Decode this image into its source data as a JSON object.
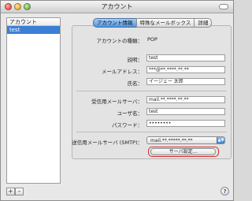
{
  "window": {
    "title": "アカウント"
  },
  "sidebar": {
    "header": "アカウント",
    "items": [
      {
        "label": "test",
        "selected": true
      }
    ],
    "add_label": "+",
    "remove_label": "–"
  },
  "tabs": [
    {
      "label": "アカウント情報",
      "active": true
    },
    {
      "label": "特殊なメールボックス",
      "active": false
    },
    {
      "label": "詳細",
      "active": false
    }
  ],
  "form": {
    "account_type_label": "アカウントの種類：",
    "account_type_value": "POP",
    "description_label": "説明：",
    "description_value": "test",
    "email_label": "メールアドレス：",
    "email_value": "***@**.****.**.**",
    "fullname_label": "氏名：",
    "fullname_value": "イージェー 太郎",
    "incoming_server_label": "受信用メールサーバ：",
    "incoming_server_value": "mail.**.****.**.**",
    "username_label": "ユーザ名：",
    "username_value": "test",
    "password_label": "パスワード：",
    "password_value": "••••••••",
    "smtp_label": "送信用メールサーバ (SMTP)：",
    "smtp_value": "mail.**.*****.**.**",
    "server_settings_button": "サーバ設定..."
  },
  "help_label": "?"
}
